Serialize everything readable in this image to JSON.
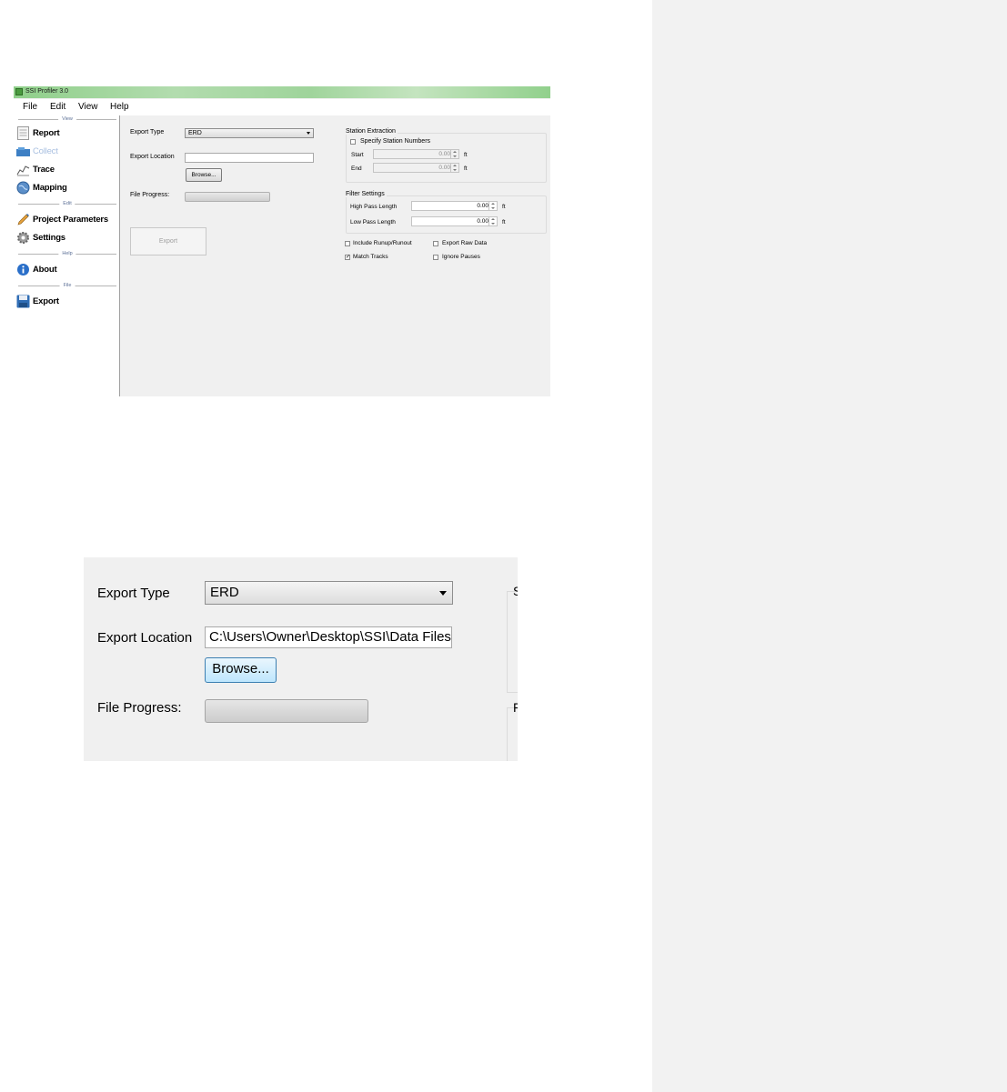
{
  "window": {
    "title": "SSI Profiler 3.0"
  },
  "menu": [
    "File",
    "Edit",
    "View",
    "Help"
  ],
  "sidebar": {
    "sections": {
      "view": "View",
      "edit": "Edit",
      "help": "Help",
      "file": "File"
    },
    "items": {
      "report": "Report",
      "collect": "Collect",
      "trace": "Trace",
      "mapping": "Mapping",
      "project_parameters": "Project Parameters",
      "settings": "Settings",
      "about": "About",
      "export": "Export"
    }
  },
  "export_form": {
    "export_type_label": "Export Type",
    "export_type_value": "ERD",
    "export_location_label": "Export Location",
    "export_location_value": "",
    "browse_label": "Browse...",
    "file_progress_label": "File Progress:",
    "file_progress_fraction": 0,
    "export_button_label": "Export"
  },
  "station_extraction": {
    "title": "Station Extraction",
    "specify_label": "Specify Station Numbers",
    "specify_checked": false,
    "start_label": "Start",
    "start_value": "0.00",
    "end_label": "End",
    "end_value": "0.00",
    "unit": "ft"
  },
  "filter_settings": {
    "title": "Filter Settings",
    "high_pass_label": "High Pass Length",
    "high_pass_value": "0.00",
    "low_pass_label": "Low Pass Length",
    "low_pass_value": "0.00",
    "unit": "ft"
  },
  "options": {
    "include_runup_label": "Include Runup/Runout",
    "include_runup_checked": false,
    "export_raw_label": "Export Raw Data",
    "export_raw_checked": false,
    "match_tracks_label": "Match Tracks",
    "match_tracks_checked": true,
    "ignore_pauses_label": "Ignore Pauses",
    "ignore_pauses_checked": false
  },
  "zoom": {
    "export_type_label": "Export Type",
    "export_type_value": "ERD",
    "export_location_label": "Export Location",
    "export_location_value": "C:\\Users\\Owner\\Desktop\\SSI\\Data Files\\F",
    "browse_label": "Browse...",
    "file_progress_label": "File Progress:",
    "edge_chars": [
      "S",
      "F"
    ]
  },
  "colors": {
    "titlebar": "#9fd49b",
    "disabled_nav": "#a8bfe0",
    "section_label": "#5b6f96",
    "side_panel": "#f2f2f2"
  }
}
